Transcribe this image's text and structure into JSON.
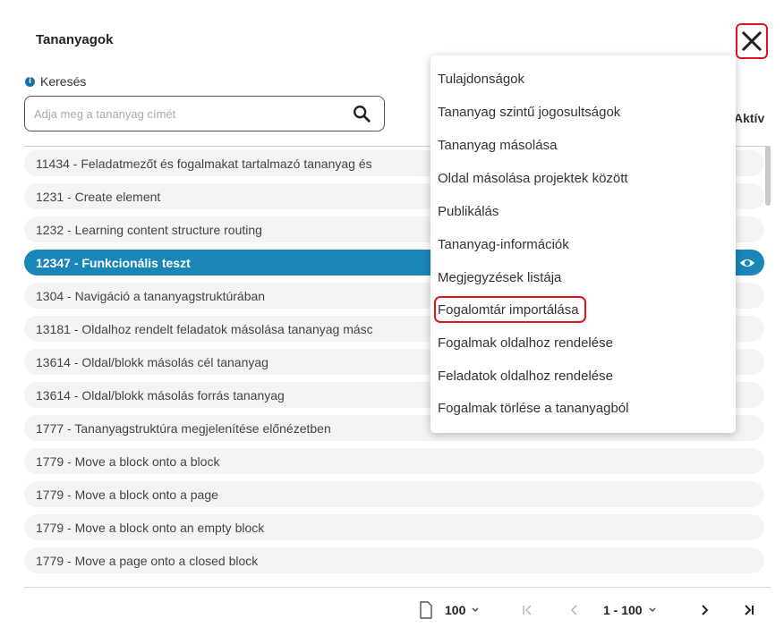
{
  "header": {
    "title": "Tananyagok"
  },
  "search": {
    "label": "Keresés",
    "placeholder": "Adja meg a tananyag címét",
    "value": ""
  },
  "columns": {
    "active": "Aktív"
  },
  "rows": [
    "11434 - Feladatmezőt és fogalmakat tartalmazó tananyag és",
    "1231 - Create element",
    "1232 - Learning content structure routing",
    "12347 - Funkcionális teszt",
    "1304 - Navigáció a tananyagstruktúrában",
    "13181 - Oldalhoz rendelt feladatok másolása tananyag másc",
    "13614 - Oldal/blokk másolás cél tananyag",
    "13614 - Oldal/blokk másolás forrás tananyag",
    "1777 - Tananyagstruktúra megjelenítése előnézetben",
    "1779 - Move a block onto a block",
    "1779 - Move a block onto a page",
    "1779 - Move a block onto an empty block",
    "1779 - Move a page onto a closed block"
  ],
  "selected_row_index": 3,
  "context_menu": {
    "items": [
      "Tulajdonságok",
      "Tananyag szintű jogosultságok",
      "Tananyag másolása",
      "Oldal másolása projektek között",
      "Publikálás",
      "Tananyag-információk",
      "Megjegyzések listája",
      "Fogalomtár importálása",
      "Fogalmak oldalhoz rendelése",
      "Feladatok oldalhoz rendelése",
      "Fogalmak törlése a tananyagból"
    ],
    "highlighted_index": 7
  },
  "pagination": {
    "page_size": "100",
    "range": "1 - 100"
  },
  "colors": {
    "accent": "#1a86b8",
    "highlight_border": "#e0141e"
  }
}
